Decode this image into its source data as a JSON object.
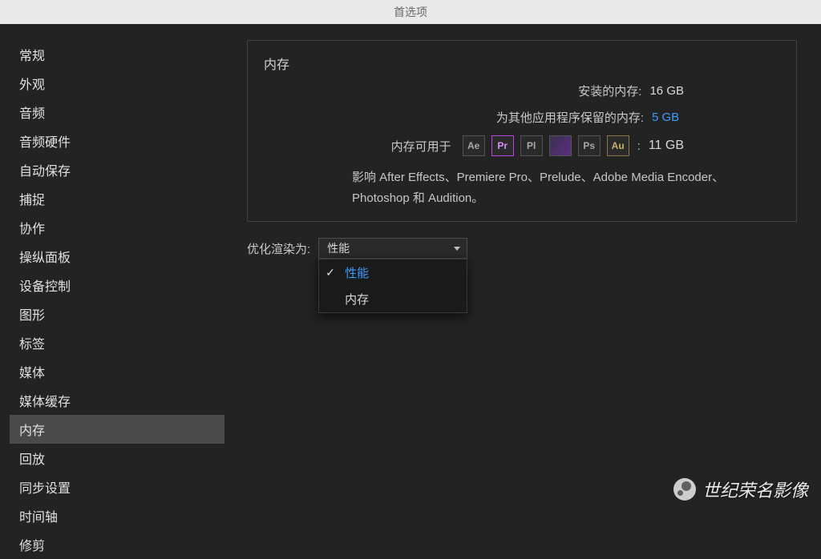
{
  "titlebar": {
    "title": "首选项"
  },
  "sidebar": {
    "items": [
      {
        "label": "常规"
      },
      {
        "label": "外观"
      },
      {
        "label": "音频"
      },
      {
        "label": "音频硬件"
      },
      {
        "label": "自动保存"
      },
      {
        "label": "捕捉"
      },
      {
        "label": "协作"
      },
      {
        "label": "操纵面板"
      },
      {
        "label": "设备控制"
      },
      {
        "label": "图形"
      },
      {
        "label": "标签"
      },
      {
        "label": "媒体"
      },
      {
        "label": "媒体缓存"
      },
      {
        "label": "内存"
      },
      {
        "label": "回放"
      },
      {
        "label": "同步设置"
      },
      {
        "label": "时间轴"
      },
      {
        "label": "修剪"
      }
    ],
    "active_index": 13
  },
  "panel": {
    "title": "内存",
    "installed_label": "安装的内存:",
    "installed_value": "16 GB",
    "reserved_label": "为其他应用程序保留的内存:",
    "reserved_value": "5 GB",
    "available_label": "内存可用于",
    "available_value": "11 GB",
    "apps": [
      "Ae",
      "Pr",
      "Pl",
      "Me",
      "Ps",
      "Au"
    ],
    "note": "影响 After Effects、Premiere Pro、Prelude、Adobe Media Encoder、Photoshop 和 Audition。"
  },
  "optimize": {
    "label": "优化渲染为:",
    "selected": "性能",
    "options": [
      {
        "label": "性能",
        "selected": true
      },
      {
        "label": "内存",
        "selected": false
      }
    ]
  },
  "watermark": {
    "text": "世纪荣名影像"
  }
}
